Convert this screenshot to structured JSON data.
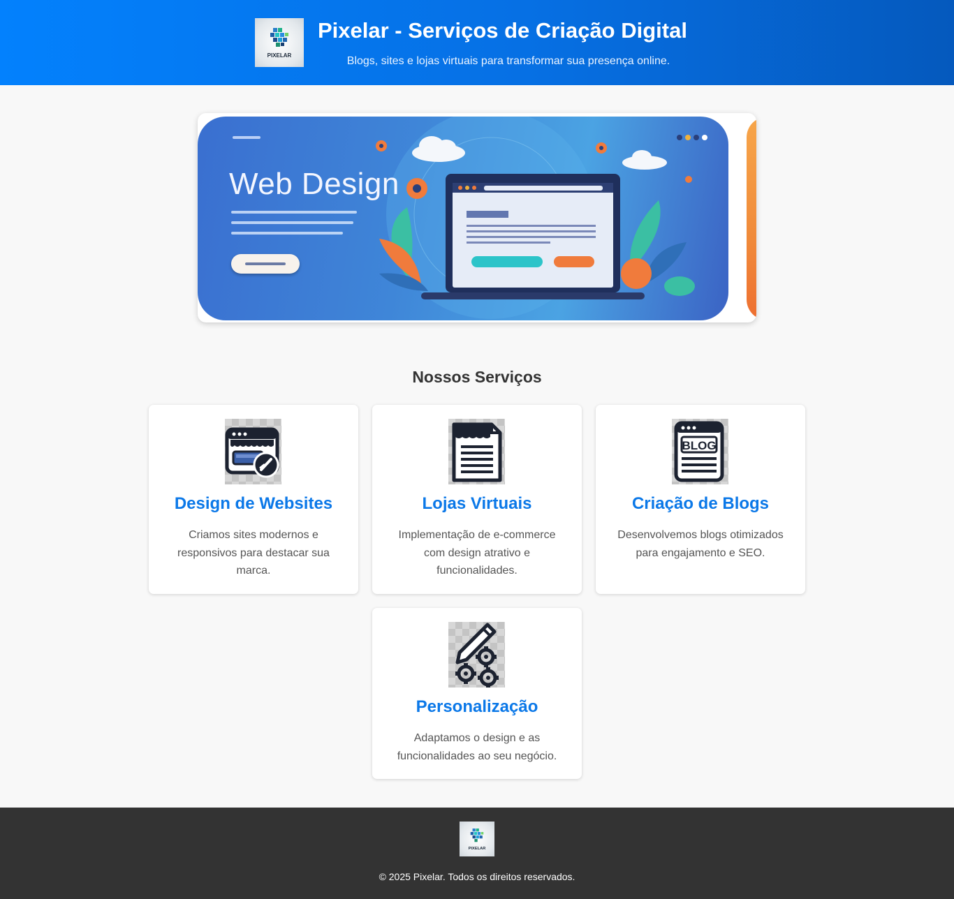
{
  "header": {
    "title": "Pixelar - Serviços de Criação Digital",
    "subtitle": "Blogs, sites e lojas virtuais para transformar sua presença online.",
    "logo_text": "PIXELAR"
  },
  "carousel": {
    "slides": [
      {
        "title": "Web Design",
        "image": "web-design-banner"
      },
      {
        "title": "",
        "image": "next-banner"
      }
    ]
  },
  "services": {
    "heading": "Nossos Serviços",
    "items": [
      {
        "title": "Design de Websites",
        "description": "Criamos sites modernos e responsivos para destacar sua marca.",
        "icon": "website-design-icon"
      },
      {
        "title": "Lojas Virtuais",
        "description": "Implementação de e-commerce com design atrativo e funcionalidades.",
        "icon": "store-document-icon"
      },
      {
        "title": "Criação de Blogs",
        "description": "Desenvolvemos blogs otimizados para engajamento e SEO.",
        "icon": "blog-icon"
      },
      {
        "title": "Personalização",
        "description": "Adaptamos o design e as funcionalidades ao seu negócio.",
        "icon": "pencil-gears-icon"
      }
    ]
  },
  "footer": {
    "copyright": "© 2025 Pixelar. Todos os direitos reservados.",
    "logo_text": "PIXELAR"
  },
  "colors": {
    "header_start": "#0381fd",
    "header_end": "#0559bd",
    "accent": "#0b78e8",
    "footer_bg": "#333333",
    "page_bg": "#f8f8f8"
  }
}
